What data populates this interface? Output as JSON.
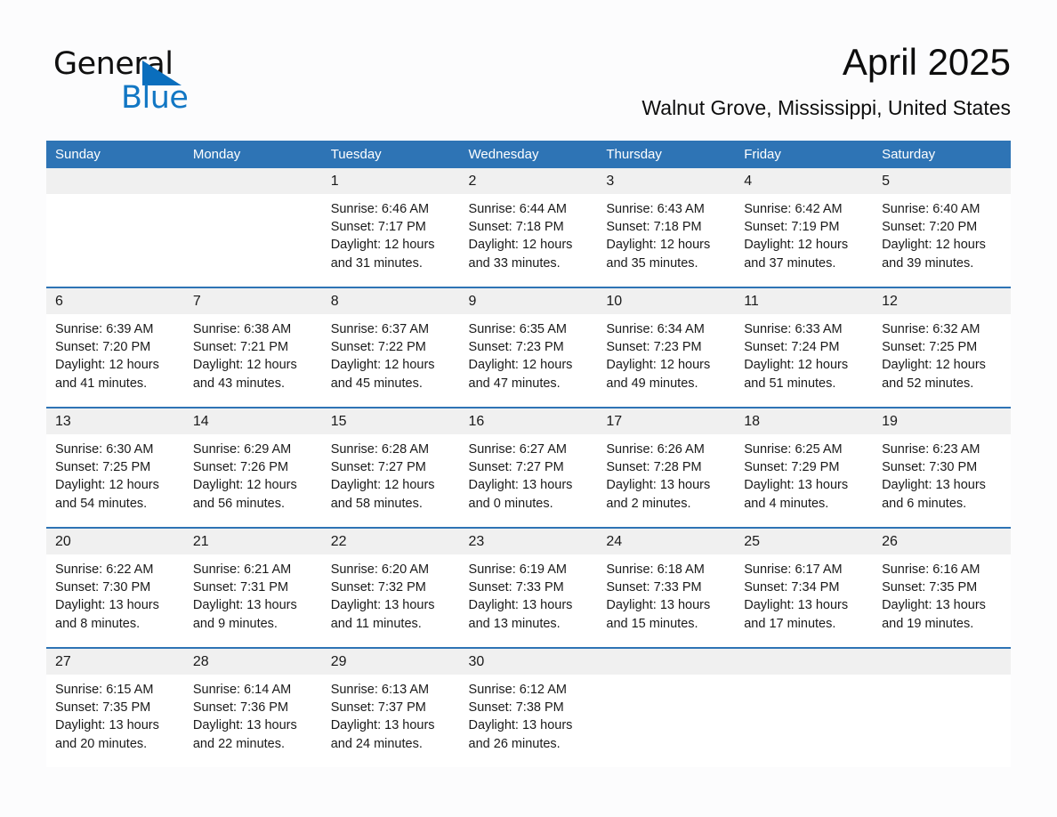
{
  "logo": {
    "word_one": "General",
    "word_two": "Blue",
    "triangle_color": "#0a6ebd",
    "blue_color": "#1277c4"
  },
  "header": {
    "title": "April 2025",
    "subtitle": "Walnut Grove, Mississippi, United States"
  },
  "theme": {
    "header_blue": "#2e74b5",
    "row_divider": "#2e74b5",
    "daynum_band": "#f0f0f0",
    "page_background": "#fcfcfd",
    "text": "#1a1a1a"
  },
  "calendar": {
    "weekday_headers": [
      "Sunday",
      "Monday",
      "Tuesday",
      "Wednesday",
      "Thursday",
      "Friday",
      "Saturday"
    ],
    "weeks": [
      [
        {
          "day": "",
          "sunrise": "",
          "sunset": "",
          "daylight_line1": "",
          "daylight_line2": "",
          "empty": true
        },
        {
          "day": "",
          "sunrise": "",
          "sunset": "",
          "daylight_line1": "",
          "daylight_line2": "",
          "empty": true
        },
        {
          "day": "1",
          "sunrise": "Sunrise: 6:46 AM",
          "sunset": "Sunset: 7:17 PM",
          "daylight_line1": "Daylight: 12 hours",
          "daylight_line2": "and 31 minutes."
        },
        {
          "day": "2",
          "sunrise": "Sunrise: 6:44 AM",
          "sunset": "Sunset: 7:18 PM",
          "daylight_line1": "Daylight: 12 hours",
          "daylight_line2": "and 33 minutes."
        },
        {
          "day": "3",
          "sunrise": "Sunrise: 6:43 AM",
          "sunset": "Sunset: 7:18 PM",
          "daylight_line1": "Daylight: 12 hours",
          "daylight_line2": "and 35 minutes."
        },
        {
          "day": "4",
          "sunrise": "Sunrise: 6:42 AM",
          "sunset": "Sunset: 7:19 PM",
          "daylight_line1": "Daylight: 12 hours",
          "daylight_line2": "and 37 minutes."
        },
        {
          "day": "5",
          "sunrise": "Sunrise: 6:40 AM",
          "sunset": "Sunset: 7:20 PM",
          "daylight_line1": "Daylight: 12 hours",
          "daylight_line2": "and 39 minutes."
        }
      ],
      [
        {
          "day": "6",
          "sunrise": "Sunrise: 6:39 AM",
          "sunset": "Sunset: 7:20 PM",
          "daylight_line1": "Daylight: 12 hours",
          "daylight_line2": "and 41 minutes."
        },
        {
          "day": "7",
          "sunrise": "Sunrise: 6:38 AM",
          "sunset": "Sunset: 7:21 PM",
          "daylight_line1": "Daylight: 12 hours",
          "daylight_line2": "and 43 minutes."
        },
        {
          "day": "8",
          "sunrise": "Sunrise: 6:37 AM",
          "sunset": "Sunset: 7:22 PM",
          "daylight_line1": "Daylight: 12 hours",
          "daylight_line2": "and 45 minutes."
        },
        {
          "day": "9",
          "sunrise": "Sunrise: 6:35 AM",
          "sunset": "Sunset: 7:23 PM",
          "daylight_line1": "Daylight: 12 hours",
          "daylight_line2": "and 47 minutes."
        },
        {
          "day": "10",
          "sunrise": "Sunrise: 6:34 AM",
          "sunset": "Sunset: 7:23 PM",
          "daylight_line1": "Daylight: 12 hours",
          "daylight_line2": "and 49 minutes."
        },
        {
          "day": "11",
          "sunrise": "Sunrise: 6:33 AM",
          "sunset": "Sunset: 7:24 PM",
          "daylight_line1": "Daylight: 12 hours",
          "daylight_line2": "and 51 minutes."
        },
        {
          "day": "12",
          "sunrise": "Sunrise: 6:32 AM",
          "sunset": "Sunset: 7:25 PM",
          "daylight_line1": "Daylight: 12 hours",
          "daylight_line2": "and 52 minutes."
        }
      ],
      [
        {
          "day": "13",
          "sunrise": "Sunrise: 6:30 AM",
          "sunset": "Sunset: 7:25 PM",
          "daylight_line1": "Daylight: 12 hours",
          "daylight_line2": "and 54 minutes."
        },
        {
          "day": "14",
          "sunrise": "Sunrise: 6:29 AM",
          "sunset": "Sunset: 7:26 PM",
          "daylight_line1": "Daylight: 12 hours",
          "daylight_line2": "and 56 minutes."
        },
        {
          "day": "15",
          "sunrise": "Sunrise: 6:28 AM",
          "sunset": "Sunset: 7:27 PM",
          "daylight_line1": "Daylight: 12 hours",
          "daylight_line2": "and 58 minutes."
        },
        {
          "day": "16",
          "sunrise": "Sunrise: 6:27 AM",
          "sunset": "Sunset: 7:27 PM",
          "daylight_line1": "Daylight: 13 hours",
          "daylight_line2": "and 0 minutes."
        },
        {
          "day": "17",
          "sunrise": "Sunrise: 6:26 AM",
          "sunset": "Sunset: 7:28 PM",
          "daylight_line1": "Daylight: 13 hours",
          "daylight_line2": "and 2 minutes."
        },
        {
          "day": "18",
          "sunrise": "Sunrise: 6:25 AM",
          "sunset": "Sunset: 7:29 PM",
          "daylight_line1": "Daylight: 13 hours",
          "daylight_line2": "and 4 minutes."
        },
        {
          "day": "19",
          "sunrise": "Sunrise: 6:23 AM",
          "sunset": "Sunset: 7:30 PM",
          "daylight_line1": "Daylight: 13 hours",
          "daylight_line2": "and 6 minutes."
        }
      ],
      [
        {
          "day": "20",
          "sunrise": "Sunrise: 6:22 AM",
          "sunset": "Sunset: 7:30 PM",
          "daylight_line1": "Daylight: 13 hours",
          "daylight_line2": "and 8 minutes."
        },
        {
          "day": "21",
          "sunrise": "Sunrise: 6:21 AM",
          "sunset": "Sunset: 7:31 PM",
          "daylight_line1": "Daylight: 13 hours",
          "daylight_line2": "and 9 minutes."
        },
        {
          "day": "22",
          "sunrise": "Sunrise: 6:20 AM",
          "sunset": "Sunset: 7:32 PM",
          "daylight_line1": "Daylight: 13 hours",
          "daylight_line2": "and 11 minutes."
        },
        {
          "day": "23",
          "sunrise": "Sunrise: 6:19 AM",
          "sunset": "Sunset: 7:33 PM",
          "daylight_line1": "Daylight: 13 hours",
          "daylight_line2": "and 13 minutes."
        },
        {
          "day": "24",
          "sunrise": "Sunrise: 6:18 AM",
          "sunset": "Sunset: 7:33 PM",
          "daylight_line1": "Daylight: 13 hours",
          "daylight_line2": "and 15 minutes."
        },
        {
          "day": "25",
          "sunrise": "Sunrise: 6:17 AM",
          "sunset": "Sunset: 7:34 PM",
          "daylight_line1": "Daylight: 13 hours",
          "daylight_line2": "and 17 minutes."
        },
        {
          "day": "26",
          "sunrise": "Sunrise: 6:16 AM",
          "sunset": "Sunset: 7:35 PM",
          "daylight_line1": "Daylight: 13 hours",
          "daylight_line2": "and 19 minutes."
        }
      ],
      [
        {
          "day": "27",
          "sunrise": "Sunrise: 6:15 AM",
          "sunset": "Sunset: 7:35 PM",
          "daylight_line1": "Daylight: 13 hours",
          "daylight_line2": "and 20 minutes."
        },
        {
          "day": "28",
          "sunrise": "Sunrise: 6:14 AM",
          "sunset": "Sunset: 7:36 PM",
          "daylight_line1": "Daylight: 13 hours",
          "daylight_line2": "and 22 minutes."
        },
        {
          "day": "29",
          "sunrise": "Sunrise: 6:13 AM",
          "sunset": "Sunset: 7:37 PM",
          "daylight_line1": "Daylight: 13 hours",
          "daylight_line2": "and 24 minutes."
        },
        {
          "day": "30",
          "sunrise": "Sunrise: 6:12 AM",
          "sunset": "Sunset: 7:38 PM",
          "daylight_line1": "Daylight: 13 hours",
          "daylight_line2": "and 26 minutes."
        },
        {
          "day": "",
          "sunrise": "",
          "sunset": "",
          "daylight_line1": "",
          "daylight_line2": "",
          "empty": true
        },
        {
          "day": "",
          "sunrise": "",
          "sunset": "",
          "daylight_line1": "",
          "daylight_line2": "",
          "empty": true
        },
        {
          "day": "",
          "sunrise": "",
          "sunset": "",
          "daylight_line1": "",
          "daylight_line2": "",
          "empty": true
        }
      ]
    ]
  }
}
